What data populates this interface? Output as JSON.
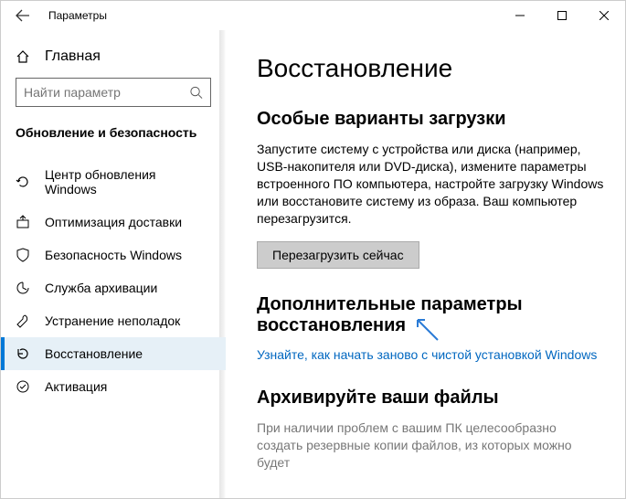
{
  "titlebar": {
    "title": "Параметры"
  },
  "sidebar": {
    "home": "Главная",
    "search_placeholder": "Найти параметр",
    "section": "Обновление и безопасность",
    "items": [
      {
        "label": "Центр обновления Windows"
      },
      {
        "label": "Оптимизация доставки"
      },
      {
        "label": "Безопасность Windows"
      },
      {
        "label": "Служба архивации"
      },
      {
        "label": "Устранение неполадок"
      },
      {
        "label": "Восстановление"
      },
      {
        "label": "Активация"
      }
    ]
  },
  "main": {
    "title": "Восстановление",
    "section1_title": "Особые варианты загрузки",
    "section1_text": "Запустите систему с устройства или диска (например, USB-накопителя или DVD-диска), измените параметры встроенного ПО компьютера, настройте загрузку Windows или восстановите систему из образа. Ваш компьютер перезагрузится.",
    "restart_btn": "Перезагрузить сейчас",
    "section2_title": "Дополнительные параметры восстановления",
    "section2_link": "Узнайте, как начать заново с чистой установкой Windows",
    "section3_title": "Архивируйте ваши файлы",
    "section3_text": "При наличии проблем с вашим ПК целесообразно создать резервные копии файлов, из которых можно будет"
  }
}
